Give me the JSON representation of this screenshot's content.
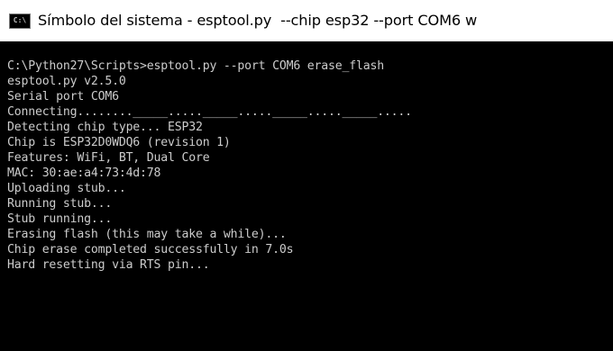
{
  "window": {
    "icon_label": "C:\\",
    "title": "Símbolo del sistema - esptool.py  --chip esp32 --port COM6 w"
  },
  "console": {
    "lines": [
      "C:\\Python27\\Scripts>esptool.py --port COM6 erase_flash",
      "esptool.py v2.5.0",
      "Serial port COM6",
      "Connecting........_____....._____....._____....._____.....",
      "Detecting chip type... ESP32",
      "Chip is ESP32D0WDQ6 (revision 1)",
      "Features: WiFi, BT, Dual Core",
      "MAC: 30:ae:a4:73:4d:78",
      "Uploading stub...",
      "Running stub...",
      "Stub running...",
      "Erasing flash (this may take a while)...",
      "Chip erase completed successfully in 7.0s",
      "Hard resetting via RTS pin..."
    ]
  },
  "colors": {
    "console_background": "#000000",
    "console_text": "#cccccc",
    "titlebar_background": "#ffffff",
    "title_text": "#000000"
  },
  "icons": {
    "app_icon": "command-prompt-icon"
  }
}
